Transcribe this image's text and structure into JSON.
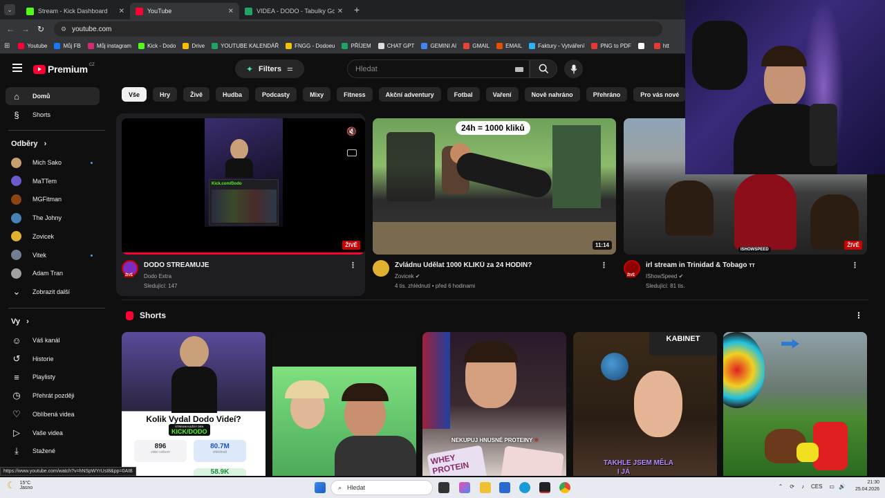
{
  "browser": {
    "tabs": [
      {
        "title": "Stream - Kick Dashboard",
        "color": "#53fc18",
        "active": false
      },
      {
        "title": "YouTube",
        "color": "#ff0033",
        "active": true
      },
      {
        "title": "VIDEA - DODO - Tabulky Googl",
        "color": "#1fa463",
        "active": false
      }
    ],
    "new_tab": "+",
    "url": "youtube.com",
    "bookmarks": [
      {
        "label": "Youtube",
        "color": "#ff0033"
      },
      {
        "label": "Můj FB",
        "color": "#1877f2"
      },
      {
        "label": "Můj instagram",
        "color": "#d62976"
      },
      {
        "label": "Kick - Dodo",
        "color": "#53fc18"
      },
      {
        "label": "Drive",
        "color": "#fbbc04"
      },
      {
        "label": "YOUTUBE KALENDÁŘ",
        "color": "#1fa463"
      },
      {
        "label": "FNGG - Dodoeu",
        "color": "#f5c400"
      },
      {
        "label": "PŘÍJEM",
        "color": "#1fa463"
      },
      {
        "label": "CHAT GPT",
        "color": "#dddddd"
      },
      {
        "label": "GEMINI AI",
        "color": "#4285f4"
      },
      {
        "label": "GMAIL",
        "color": "#ea4335"
      },
      {
        "label": "EMAIL",
        "color": "#e65100"
      },
      {
        "label": "Faktury - Vytváření",
        "color": "#29b6f6"
      },
      {
        "label": "PNG to PDF",
        "color": "#e53935"
      },
      {
        "label": "",
        "color": "#ffffff"
      },
      {
        "label": "htt",
        "color": "#e53935"
      }
    ]
  },
  "youtube": {
    "logo": "Premium",
    "region": "CZ",
    "filters_label": "Filters",
    "search_placeholder": "Hledat",
    "chips": [
      "Vše",
      "Hry",
      "Živě",
      "Hudba",
      "Podcasty",
      "Mixy",
      "Fitness",
      "Akční adventury",
      "Fotbal",
      "Vaření",
      "Nově nahráno",
      "Přehráno",
      "Pro vás nové"
    ],
    "sidebar": {
      "main": [
        {
          "label": "Domů",
          "icon": "home-icon",
          "glyph": "⌂",
          "selected": true
        },
        {
          "label": "Shorts",
          "icon": "shorts-icon",
          "glyph": "§",
          "selected": false
        }
      ],
      "subs_header": "Odběry",
      "subs": [
        {
          "label": "Mich Sako",
          "color": "#c8a070",
          "dot": true
        },
        {
          "label": "MaTTem",
          "color": "#6a5acd",
          "dot": false
        },
        {
          "label": "MGFitman",
          "color": "#8b4513",
          "dot": false
        },
        {
          "label": "The Johny",
          "color": "#4682b4",
          "dot": false
        },
        {
          "label": "Zovicek",
          "color": "#e0b030",
          "dot": false
        },
        {
          "label": "Vitek",
          "color": "#708090",
          "dot": true
        },
        {
          "label": "Adam Tran",
          "color": "#a0a0a0",
          "dot": false
        }
      ],
      "show_more": "Zobrazit další",
      "you_header": "Vy",
      "you": [
        {
          "label": "Váš kanál",
          "icon": "user-icon",
          "glyph": "☺"
        },
        {
          "label": "Historie",
          "icon": "history-icon",
          "glyph": "↺"
        },
        {
          "label": "Playlisty",
          "icon": "playlist-icon",
          "glyph": "≡"
        },
        {
          "label": "Přehrát později",
          "icon": "clock-icon",
          "glyph": "◷"
        },
        {
          "label": "Oblíbená videa",
          "icon": "thumbs-up-icon",
          "glyph": "♡"
        },
        {
          "label": "Vaše videa",
          "icon": "video-icon",
          "glyph": "▷"
        },
        {
          "label": "Stažené",
          "icon": "download-icon",
          "glyph": "⤓"
        }
      ]
    },
    "videos": [
      {
        "title": "DODO STREAMUJE",
        "channel": "Dodo Extra",
        "meta": "Sledující: 147",
        "badge": "ŽIVĚ",
        "live": true,
        "verified": false,
        "avatar": "#7b2cbf",
        "avatar_label": "ŽIVĚ",
        "stream_url": "Kick.com/Dodo"
      },
      {
        "title": "Zvládnu Udělat 1000 KLIKŮ za 24 HODIN?",
        "channel": "Zovicek",
        "meta": "4 tis. zhlédnutí • před 6 hodinami",
        "badge": "11:14",
        "live": false,
        "verified": true,
        "avatar": "#e0b030",
        "overlay": "24h = 1000 kliků"
      },
      {
        "title": "irl stream in Trinidad & Tobago",
        "channel": "IShowSpeed",
        "meta": "Sledující: 81 tis.",
        "badge": "ŽIVĚ",
        "live": true,
        "verified": true,
        "avatar": "#8b0000",
        "avatar_label": "ŽIVĚ",
        "overlay": "ISHOWSPEED"
      }
    ],
    "shorts_header": "Shorts",
    "shorts": [
      {
        "overlay": "Kolik Vydal Dodo Videí?",
        "stats": [
          "896",
          "80.7M",
          "58.9K"
        ],
        "stats_label": "videí celkem",
        "stats_label2": "zhlédnutí",
        "logo_text": "KICK/DODO",
        "logo_sub": "STREAM KAŽDÝ DEN"
      },
      {
        "overlay": ""
      },
      {
        "overlay": "NEKUPUJ HNUSNÉ PROTEINY",
        "brand": "WHEY PROTEIN"
      },
      {
        "overlay": "TAKHLE JSEM MĚLA",
        "sub": "I JÁ",
        "sign": "KABINET"
      },
      {
        "overlay": ""
      }
    ],
    "status_url": "https://www.youtube.com/watch?v=hNSpWYrUsI8&pp=0AIB"
  },
  "taskbar": {
    "weather_temp": "15°C",
    "weather_desc": "Jasno",
    "search": "Hledat",
    "lang": "CES",
    "time": "21:30",
    "date": "25.04.2026"
  }
}
